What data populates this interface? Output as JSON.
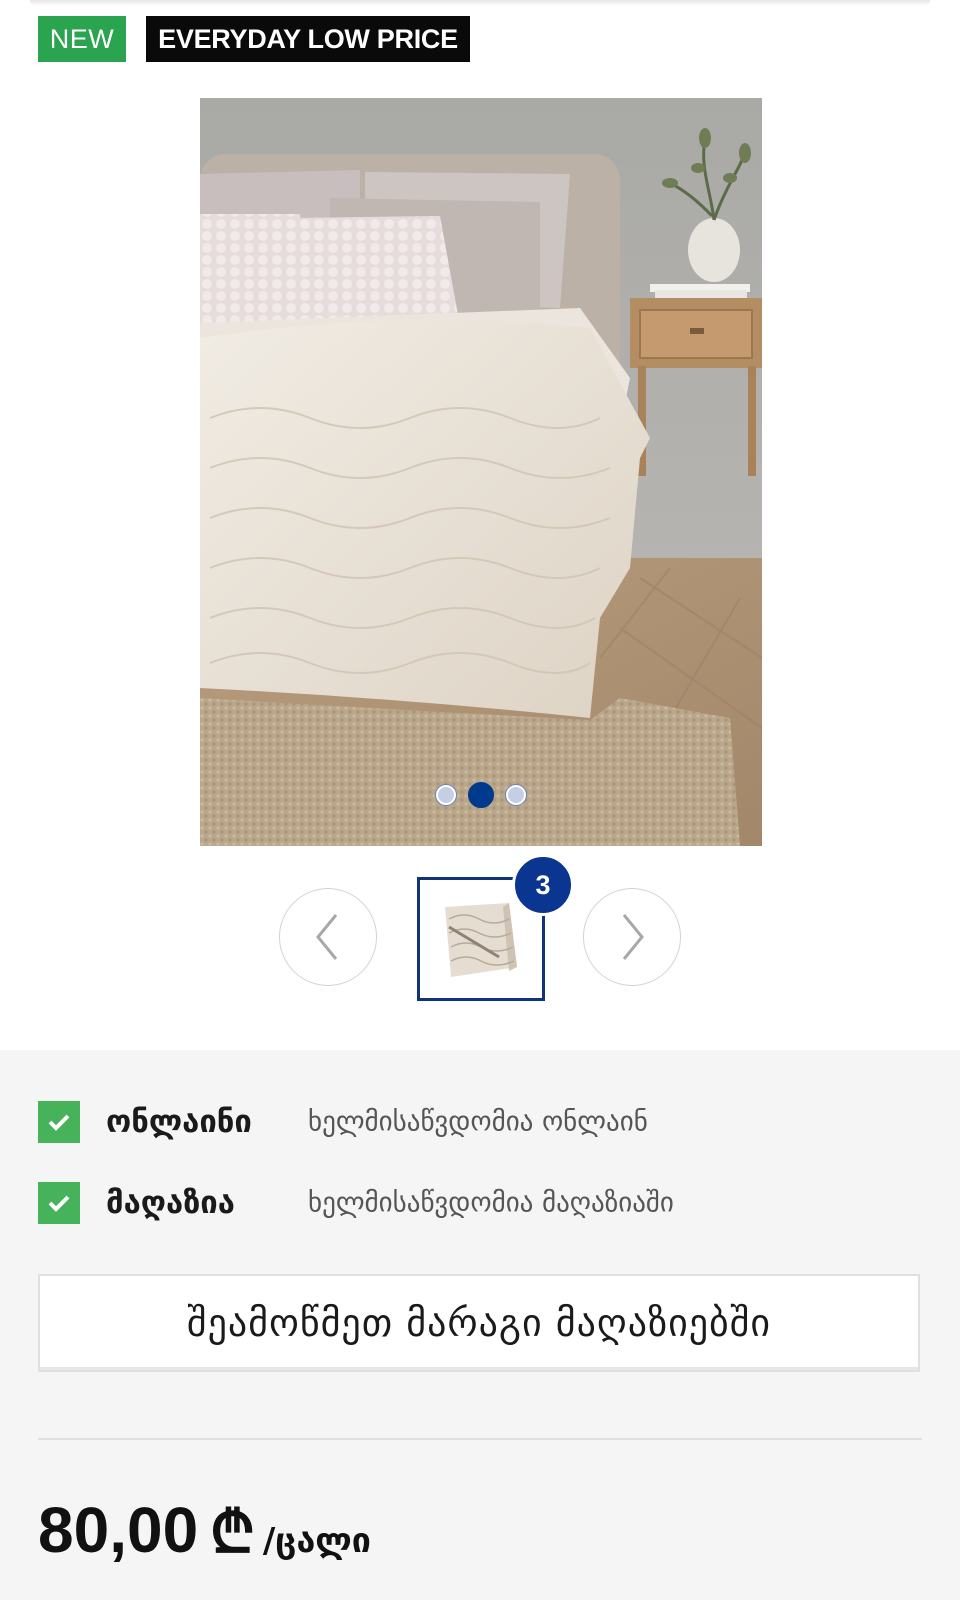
{
  "badges": {
    "new": "NEW",
    "price_tag": "EVERYDAY LOW PRICE"
  },
  "gallery": {
    "slide_count": 3,
    "active_slide": 2,
    "thumbnail_count": "3"
  },
  "availability": [
    {
      "label": "ონლაინი",
      "description": "ხელმისაწვდომია ონლაინ"
    },
    {
      "label": "მაღაზია",
      "description": "ხელმისაწვდომია მაღაზიაში"
    }
  ],
  "stock_button": "შეამოწმეთ მარაგი მაღაზიებში",
  "price": {
    "value": "80,00",
    "currency": "₾",
    "unit": "/ცალი"
  },
  "colors": {
    "new_badge": "#2aa44f",
    "price_badge": "#0a0a0a",
    "accent_blue": "#0a3591",
    "check_green": "#46b25a"
  }
}
